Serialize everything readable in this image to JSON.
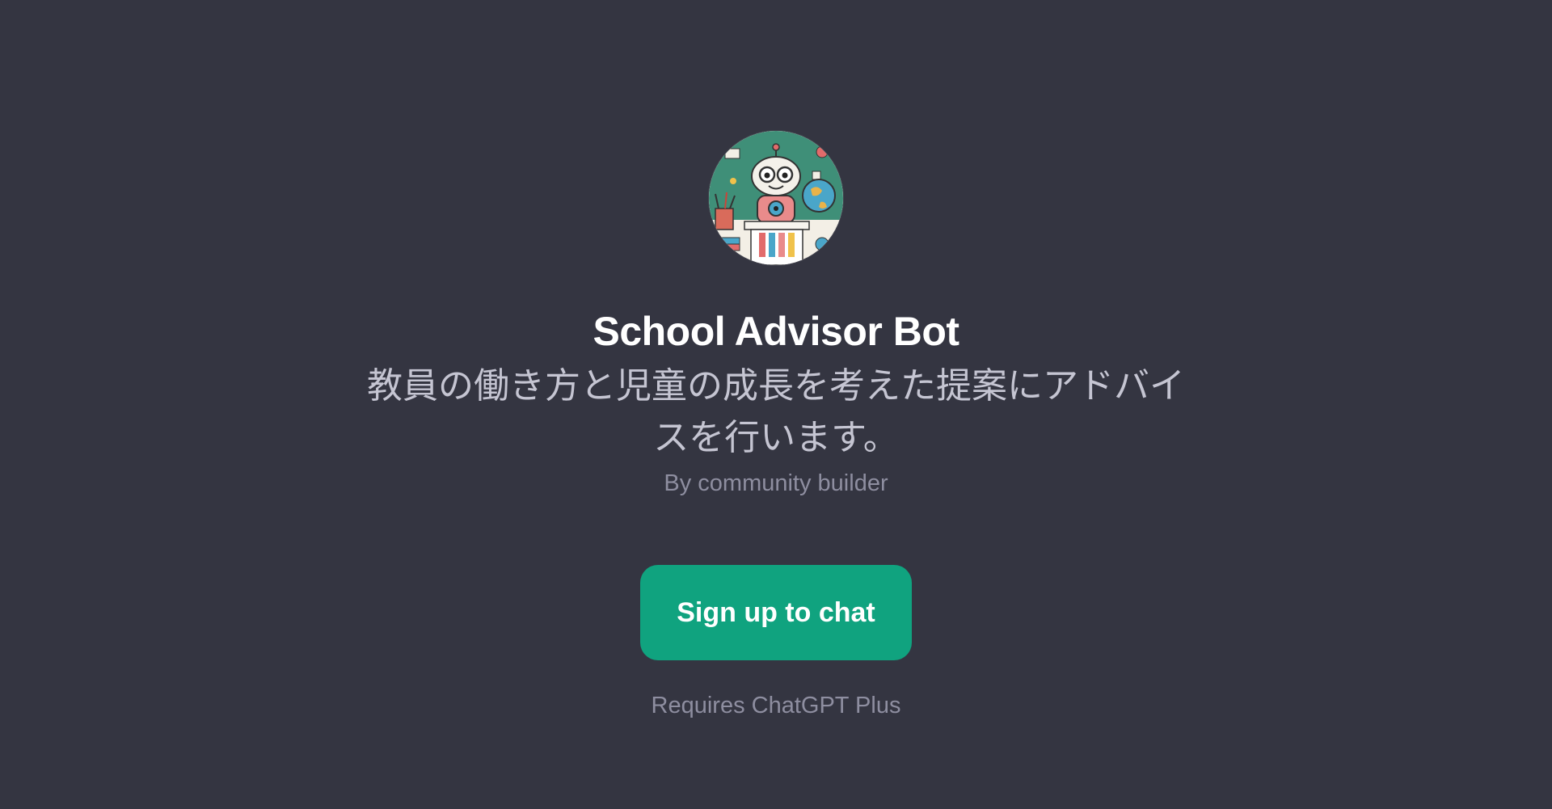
{
  "gpt": {
    "avatar_icon": "robot-teacher-avatar",
    "title": "School Advisor Bot",
    "description": "教員の働き方と児童の成長を考えた提案にアドバイスを行います。",
    "author": "By community builder"
  },
  "cta": {
    "label": "Sign up to chat",
    "requirement": "Requires ChatGPT Plus"
  },
  "colors": {
    "background": "#343541",
    "accent": "#10a37f",
    "title": "#ffffff",
    "muted": "#8e8ea0"
  }
}
